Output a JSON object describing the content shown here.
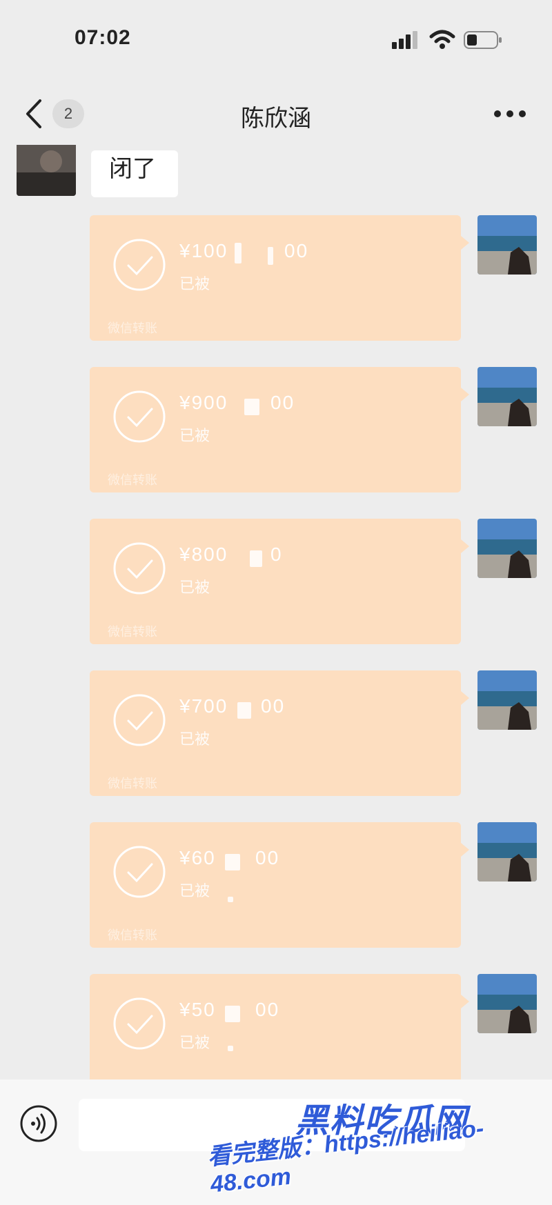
{
  "status_bar": {
    "time": "07:02"
  },
  "nav": {
    "badge": "2",
    "title": "陈欣涵"
  },
  "messages": {
    "incoming_text": "闭了",
    "transfers": [
      {
        "amount": "¥100",
        "amount_tail": "00",
        "status": "已被",
        "foot": "微信转账"
      },
      {
        "amount": "¥900",
        "amount_tail": "00",
        "status": "已被",
        "foot": "微信转账"
      },
      {
        "amount": "¥800",
        "amount_tail": "0",
        "status": "已被",
        "foot": "微信转账"
      },
      {
        "amount": "¥700",
        "amount_tail": "00",
        "status": "已被",
        "foot": "微信转账"
      },
      {
        "amount": "¥60",
        "amount_tail": "00",
        "status": "已被",
        "foot": "微信转账"
      },
      {
        "amount": "¥50",
        "amount_tail": "00",
        "status": "已被",
        "foot": ""
      }
    ]
  },
  "input": {
    "value": ""
  },
  "watermark": {
    "brand": "黑料吃瓜网",
    "url": "看完整版：https://heiliao-48.com"
  },
  "colors": {
    "transfer_bg": "#fddec0",
    "page_bg": "#ededed",
    "watermark": "#2f5bd8"
  },
  "icons": [
    "back-icon",
    "more-icon",
    "check-icon",
    "voice-icon",
    "signal-icon",
    "wifi-icon",
    "battery-icon"
  ]
}
